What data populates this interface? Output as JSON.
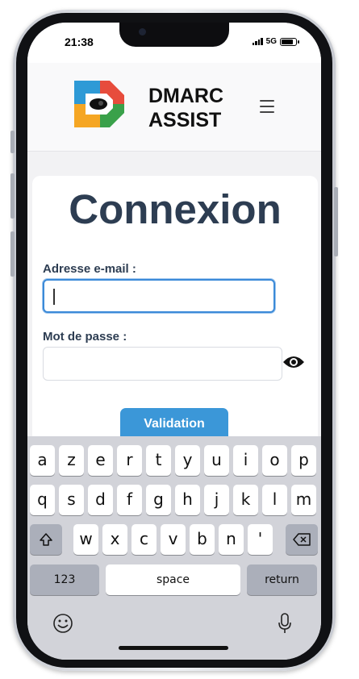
{
  "status_bar": {
    "time": "21:38",
    "network": "5G",
    "battery_level": 0.85
  },
  "header": {
    "brand_line1": "DMARC",
    "brand_line2": "ASSIST",
    "logo_colors": [
      "#e74c3c",
      "#2e9ad6",
      "#f5a623",
      "#3aa14a"
    ]
  },
  "login": {
    "title": "Connexion",
    "email_label": "Adresse e-mail :",
    "email_value": "",
    "password_label": "Mot de passe :",
    "password_value": "",
    "submit_label": "Validation"
  },
  "keyboard": {
    "row1": [
      "a",
      "z",
      "e",
      "r",
      "t",
      "y",
      "u",
      "i",
      "o",
      "p"
    ],
    "row2": [
      "q",
      "s",
      "d",
      "f",
      "g",
      "h",
      "j",
      "k",
      "l",
      "m"
    ],
    "row3": [
      "w",
      "x",
      "c",
      "v",
      "b",
      "n",
      "'"
    ],
    "numbers_key": "123",
    "space_key": "space",
    "return_key": "return"
  },
  "colors": {
    "accent": "#3b97d8",
    "title": "#2d3d52",
    "focus_border": "#3b8ad8"
  }
}
